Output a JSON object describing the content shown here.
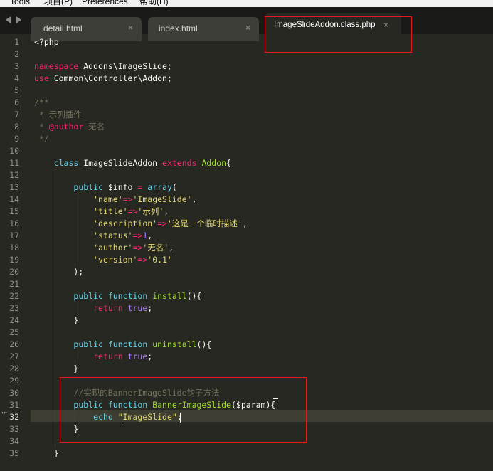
{
  "menu": [
    "Tools",
    "项目(P)",
    "Preferences",
    "帮助(H)"
  ],
  "tabs": [
    {
      "label": "detail.html",
      "close": "×",
      "active": false
    },
    {
      "label": "index.html",
      "close": "×",
      "active": false
    },
    {
      "label": "ImageSlideAddon.class.php",
      "close": "×",
      "active": true
    }
  ],
  "editor": {
    "current_line": 32,
    "fold_marker": "“”",
    "line_numbers": [
      "1",
      "2",
      "3",
      "4",
      "5",
      "6",
      "7",
      "8",
      "9",
      "10",
      "11",
      "12",
      "13",
      "14",
      "15",
      "16",
      "17",
      "18",
      "19",
      "20",
      "21",
      "22",
      "23",
      "24",
      "25",
      "26",
      "27",
      "28",
      "29",
      "30",
      "31",
      "32",
      "33",
      "34",
      "35"
    ],
    "lines": [
      [
        [
          "pl",
          "<?php"
        ]
      ],
      [],
      [
        [
          "kw",
          "namespace"
        ],
        [
          "pl",
          " Addons\\ImageSlide;"
        ]
      ],
      [
        [
          "kw",
          "use"
        ],
        [
          "pl",
          " Common\\Controller\\Addon;"
        ]
      ],
      [],
      [
        [
          "cm",
          "/**"
        ]
      ],
      [
        [
          "cm",
          " * 示列插件"
        ]
      ],
      [
        [
          "cm",
          " * "
        ],
        [
          "kw",
          "@author"
        ],
        [
          "cm",
          " 无名"
        ]
      ],
      [
        [
          "cm",
          " */"
        ]
      ],
      [],
      [
        [
          "pl",
          "    "
        ],
        [
          "st",
          "class"
        ],
        [
          "pl",
          " ImageSlideAddon "
        ],
        [
          "kw",
          "extends"
        ],
        [
          "pl",
          " "
        ],
        [
          "fn",
          "Addon"
        ],
        [
          "pl",
          "{"
        ]
      ],
      [],
      [
        [
          "pl",
          "        "
        ],
        [
          "st",
          "public"
        ],
        [
          "pl",
          " $info "
        ],
        [
          "kw",
          "="
        ],
        [
          "pl",
          " "
        ],
        [
          "st",
          "array"
        ],
        [
          "pl",
          "("
        ]
      ],
      [
        [
          "pl",
          "            "
        ],
        [
          "sv",
          "'name'"
        ],
        [
          "kw",
          "=>"
        ],
        [
          "sv",
          "'ImageSlide'"
        ],
        [
          "pl",
          ","
        ]
      ],
      [
        [
          "pl",
          "            "
        ],
        [
          "sv",
          "'title'"
        ],
        [
          "kw",
          "=>"
        ],
        [
          "sv",
          "'示列'"
        ],
        [
          "pl",
          ","
        ]
      ],
      [
        [
          "pl",
          "            "
        ],
        [
          "sv",
          "'description'"
        ],
        [
          "kw",
          "=>"
        ],
        [
          "sv",
          "'这是一个临时描述'"
        ],
        [
          "pl",
          ","
        ]
      ],
      [
        [
          "pl",
          "            "
        ],
        [
          "sv",
          "'status'"
        ],
        [
          "kw",
          "=>"
        ],
        [
          "num",
          "1"
        ],
        [
          "pl",
          ","
        ]
      ],
      [
        [
          "pl",
          "            "
        ],
        [
          "sv",
          "'author'"
        ],
        [
          "kw",
          "=>"
        ],
        [
          "sv",
          "'无名'"
        ],
        [
          "pl",
          ","
        ]
      ],
      [
        [
          "pl",
          "            "
        ],
        [
          "sv",
          "'version'"
        ],
        [
          "kw",
          "=>"
        ],
        [
          "sv",
          "'0.1'"
        ]
      ],
      [
        [
          "pl",
          "        );"
        ]
      ],
      [],
      [
        [
          "pl",
          "        "
        ],
        [
          "st",
          "public"
        ],
        [
          "pl",
          " "
        ],
        [
          "st",
          "function"
        ],
        [
          "pl",
          " "
        ],
        [
          "fn",
          "install"
        ],
        [
          "pl",
          "(){"
        ]
      ],
      [
        [
          "pl",
          "            "
        ],
        [
          "kw",
          "return"
        ],
        [
          "pl",
          " "
        ],
        [
          "num",
          "true"
        ],
        [
          "pl",
          ";"
        ]
      ],
      [
        [
          "pl",
          "        }"
        ]
      ],
      [],
      [
        [
          "pl",
          "        "
        ],
        [
          "st",
          "public"
        ],
        [
          "pl",
          " "
        ],
        [
          "st",
          "function"
        ],
        [
          "pl",
          " "
        ],
        [
          "fn",
          "uninstall"
        ],
        [
          "pl",
          "(){"
        ]
      ],
      [
        [
          "pl",
          "            "
        ],
        [
          "kw",
          "return"
        ],
        [
          "pl",
          " "
        ],
        [
          "num",
          "true"
        ],
        [
          "pl",
          ";"
        ]
      ],
      [
        [
          "pl",
          "        }"
        ]
      ],
      [],
      [
        [
          "pl",
          "        "
        ],
        [
          "cm",
          "//实现的BannerImageSlide钩子方法"
        ]
      ],
      [
        [
          "pl",
          "        "
        ],
        [
          "st",
          "public"
        ],
        [
          "pl",
          " "
        ],
        [
          "st",
          "function"
        ],
        [
          "pl",
          " "
        ],
        [
          "fn",
          "BannerImageSlide"
        ],
        [
          "pl",
          "($param){"
        ]
      ],
      [
        [
          "pl",
          "            "
        ],
        [
          "st",
          "echo"
        ],
        [
          "pl",
          " "
        ],
        [
          "sv",
          "\"ImageSlide\""
        ],
        [
          "pl",
          ";"
        ]
      ],
      [
        [
          "pl",
          "        }"
        ]
      ],
      [],
      [
        [
          "pl",
          "    }"
        ]
      ]
    ]
  }
}
